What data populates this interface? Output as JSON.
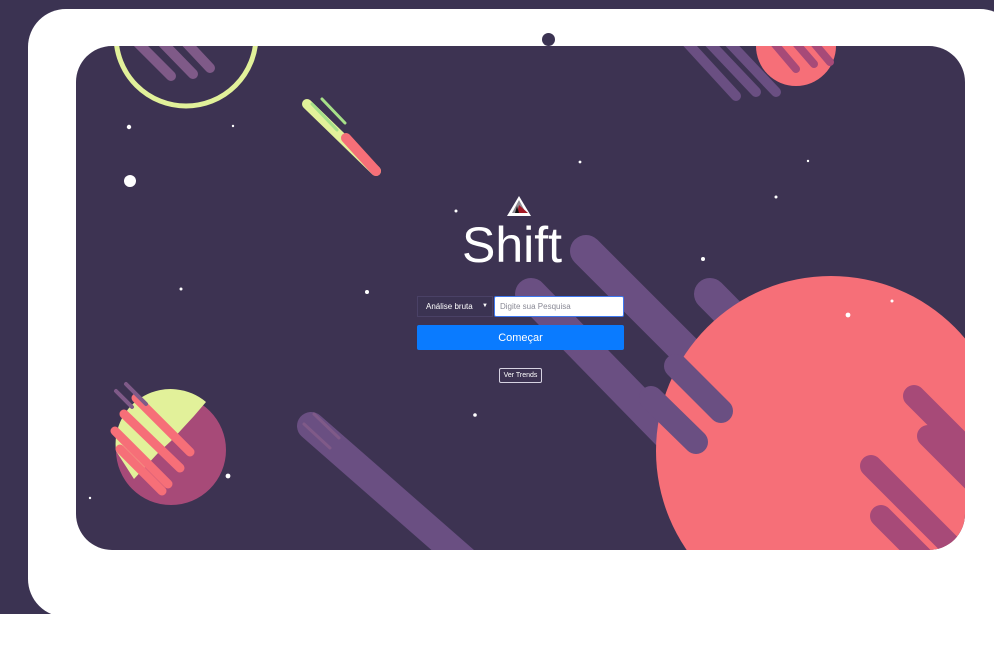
{
  "app": {
    "brand_name": "Shift"
  },
  "search": {
    "mode_selected": "Análise bruta",
    "placeholder": "Digite sua Pesquisa",
    "value": ""
  },
  "actions": {
    "start_label": "Começar",
    "trends_label": "Ver Trends"
  },
  "colors": {
    "page_background": "#3b3352",
    "device_frame": "#ffffff",
    "screen_background": "#3d3352",
    "planet_coral": "#f66f78",
    "planet_magenta": "#a74a78",
    "comet_lime": "#e2f19a",
    "primary_button": "#0a7bff"
  },
  "icons": {
    "camera": "camera-dot",
    "logo_mark": "triangle-logo",
    "dropdown": "caret-down"
  }
}
